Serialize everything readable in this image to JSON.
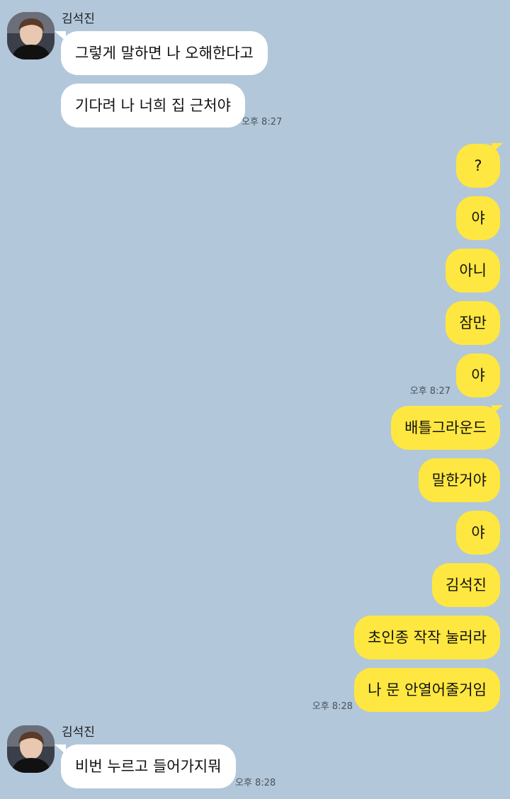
{
  "chat": {
    "contact_name": "김석진",
    "messages": [
      {
        "dir": "in",
        "text": "그렇게 말하면 나 오해한다고"
      },
      {
        "dir": "in",
        "text": "기다려 나 너희 집 근처야",
        "time": "오후 8:27"
      },
      {
        "dir": "out",
        "text": "?"
      },
      {
        "dir": "out",
        "text": "야"
      },
      {
        "dir": "out",
        "text": "아니"
      },
      {
        "dir": "out",
        "text": "잠만"
      },
      {
        "dir": "out",
        "text": "야",
        "time": "오후 8:27"
      },
      {
        "dir": "out",
        "text": "배틀그라운드"
      },
      {
        "dir": "out",
        "text": "말한거야"
      },
      {
        "dir": "out",
        "text": "야"
      },
      {
        "dir": "out",
        "text": "김석진"
      },
      {
        "dir": "out",
        "text": "초인종 작작 눌러라"
      },
      {
        "dir": "out",
        "text": "나 문 안열어줄거임",
        "time": "오후 8:28"
      },
      {
        "dir": "in",
        "text": "비번 누르고 들어가지뭐",
        "time": "오후 8:28"
      }
    ]
  },
  "colors": {
    "background": "#b2c7da",
    "incoming_bubble": "#ffffff",
    "outgoing_bubble": "#fee740"
  },
  "icons": {
    "avatar": "profile-photo"
  }
}
